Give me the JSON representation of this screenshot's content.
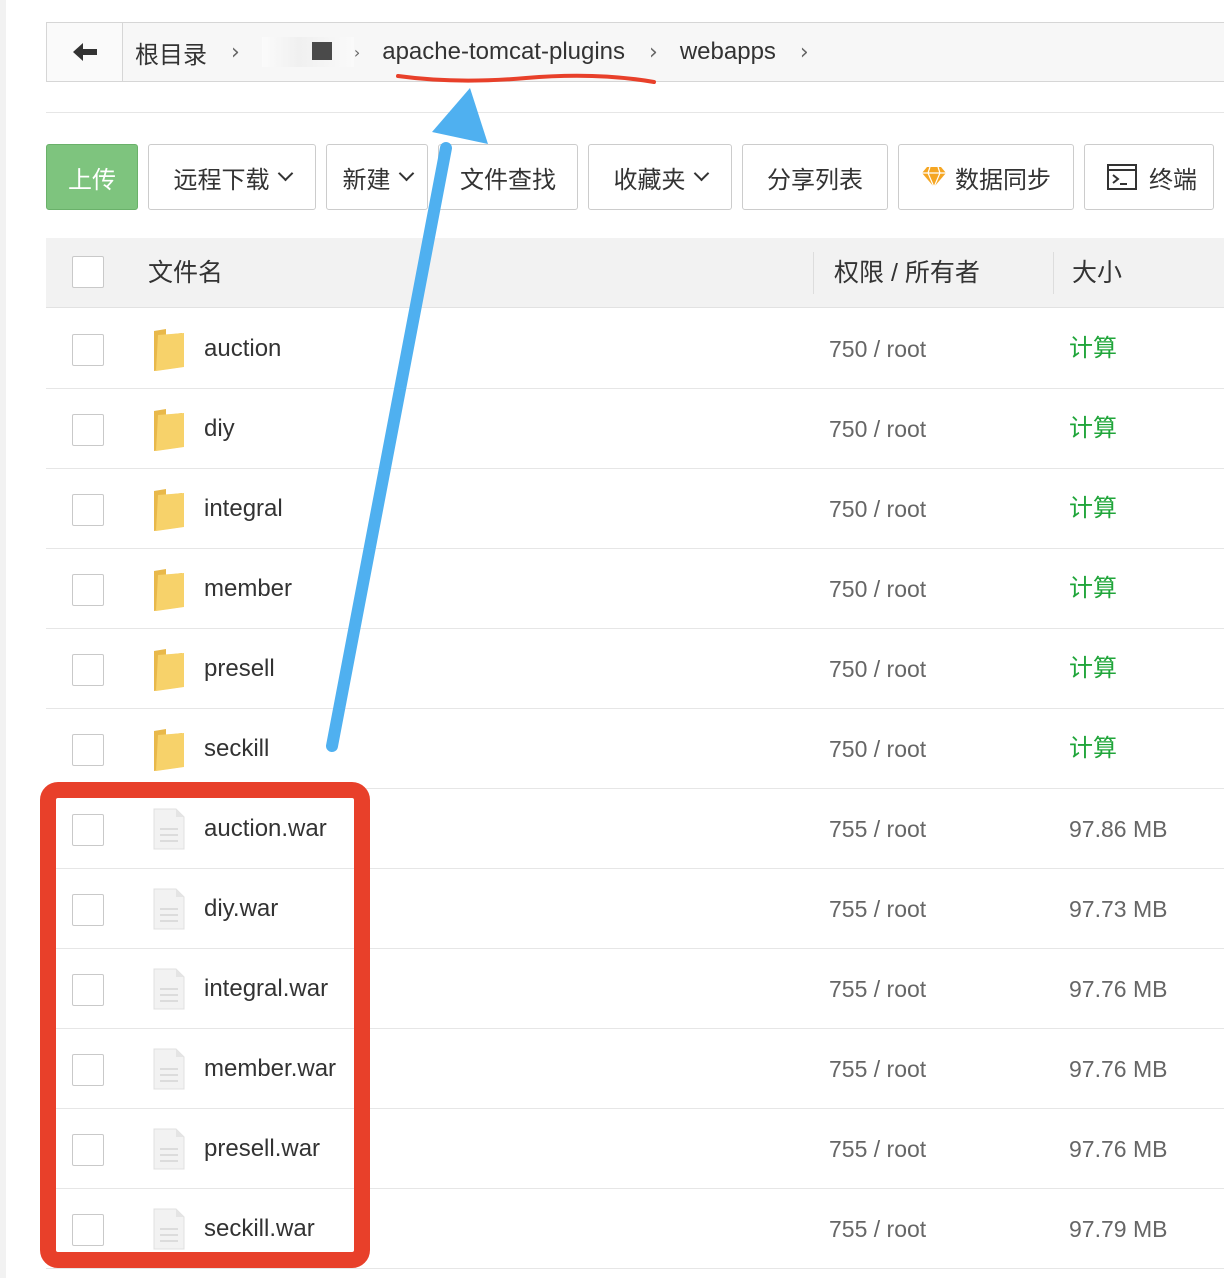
{
  "breadcrumb": {
    "items": [
      {
        "label": "根目录"
      },
      {
        "label": ""
      },
      {
        "label": "apache-tomcat-plugins"
      },
      {
        "label": "webapps"
      }
    ]
  },
  "toolbar": {
    "upload": "上传",
    "remote_download": "远程下载",
    "new": "新建",
    "file_search": "文件查找",
    "favorites": "收藏夹",
    "share_list": "分享列表",
    "data_sync": "数据同步",
    "terminal": "终端"
  },
  "table": {
    "headers": {
      "name": "文件名",
      "permission": "权限 / 所有者",
      "size": "大小"
    },
    "rows": [
      {
        "name": "auction",
        "type": "folder",
        "permission": "750 / root",
        "size": "计算"
      },
      {
        "name": "diy",
        "type": "folder",
        "permission": "750 / root",
        "size": "计算"
      },
      {
        "name": "integral",
        "type": "folder",
        "permission": "750 / root",
        "size": "计算"
      },
      {
        "name": "member",
        "type": "folder",
        "permission": "750 / root",
        "size": "计算"
      },
      {
        "name": "presell",
        "type": "folder",
        "permission": "750 / root",
        "size": "计算"
      },
      {
        "name": "seckill",
        "type": "folder",
        "permission": "750 / root",
        "size": "计算"
      },
      {
        "name": "auction.war",
        "type": "file",
        "permission": "755 / root",
        "size": "97.86 MB"
      },
      {
        "name": "diy.war",
        "type": "file",
        "permission": "755 / root",
        "size": "97.73 MB"
      },
      {
        "name": "integral.war",
        "type": "file",
        "permission": "755 / root",
        "size": "97.76 MB"
      },
      {
        "name": "member.war",
        "type": "file",
        "permission": "755 / root",
        "size": "97.76 MB"
      },
      {
        "name": "presell.war",
        "type": "file",
        "permission": "755 / root",
        "size": "97.76 MB"
      },
      {
        "name": "seckill.war",
        "type": "file",
        "permission": "755 / root",
        "size": "97.79 MB"
      }
    ]
  },
  "colors": {
    "upload_green": "#7ec47e",
    "calc_green": "#20a53a",
    "annotation_red": "#e8402a",
    "annotation_blue": "#4fb0f0",
    "folder_yellow": "#f7d26a"
  },
  "icons": {
    "back": "arrow-left-icon",
    "folder": "folder-icon",
    "file": "file-icon",
    "diamond": "diamond-icon",
    "terminal": "terminal-icon"
  }
}
